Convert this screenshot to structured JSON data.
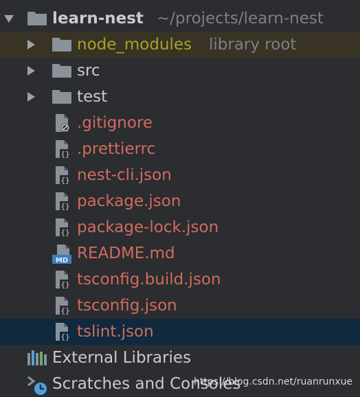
{
  "project": {
    "name": "learn-nest",
    "path": "~/projects/learn-nest"
  },
  "folders": [
    {
      "label": "node_modules",
      "hint": "library root"
    },
    {
      "label": "src"
    },
    {
      "label": "test"
    }
  ],
  "files": [
    {
      "label": ".gitignore",
      "icon": "gitignore-file-icon"
    },
    {
      "label": ".prettierrc",
      "icon": "json-file-icon"
    },
    {
      "label": "nest-cli.json",
      "icon": "json-file-icon"
    },
    {
      "label": "package.json",
      "icon": "json-file-icon"
    },
    {
      "label": "package-lock.json",
      "icon": "json-file-icon"
    },
    {
      "label": "README.md",
      "icon": "markdown-file-icon",
      "badge": "MD"
    },
    {
      "label": "tsconfig.build.json",
      "icon": "json-file-icon"
    },
    {
      "label": "tsconfig.json",
      "icon": "json-file-icon"
    },
    {
      "label": "tslint.json",
      "icon": "json-file-icon"
    }
  ],
  "footer": {
    "external_libraries": "External Libraries",
    "scratches": "Scratches and Consoles"
  },
  "watermark": "https://blog.csdn.net/ruanrunxue",
  "colors": {
    "background": "#2b2d30",
    "selected_row": "#0f2a3f",
    "library_root_row": "#383325",
    "ignored_file_text": "#d26b5d",
    "library_root_text": "#a9a222"
  }
}
